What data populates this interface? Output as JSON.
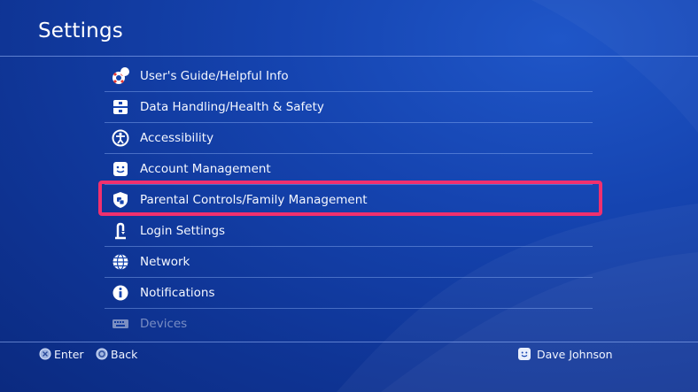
{
  "header": {
    "title": "Settings"
  },
  "menu": {
    "items": [
      {
        "label": "User's Guide/Helpful Info",
        "icon": "lifebuoy-info-icon"
      },
      {
        "label": "Data Handling/Health & Safety",
        "icon": "data-handling-icon"
      },
      {
        "label": "Accessibility",
        "icon": "accessibility-icon"
      },
      {
        "label": "Account Management",
        "icon": "account-face-icon"
      },
      {
        "label": "Parental Controls/Family Management",
        "icon": "parental-shield-icon",
        "selected": true
      },
      {
        "label": "Login Settings",
        "icon": "login-icon"
      },
      {
        "label": "Network",
        "icon": "globe-icon"
      },
      {
        "label": "Notifications",
        "icon": "info-icon"
      },
      {
        "label": "Devices",
        "icon": "devices-keyboard-icon"
      }
    ]
  },
  "footer": {
    "enter_label": "Enter",
    "back_label": "Back",
    "user_name": "Dave Johnson"
  },
  "colors": {
    "background": "#1544b0",
    "highlight": "#f0306e",
    "text": "#ffffff"
  }
}
